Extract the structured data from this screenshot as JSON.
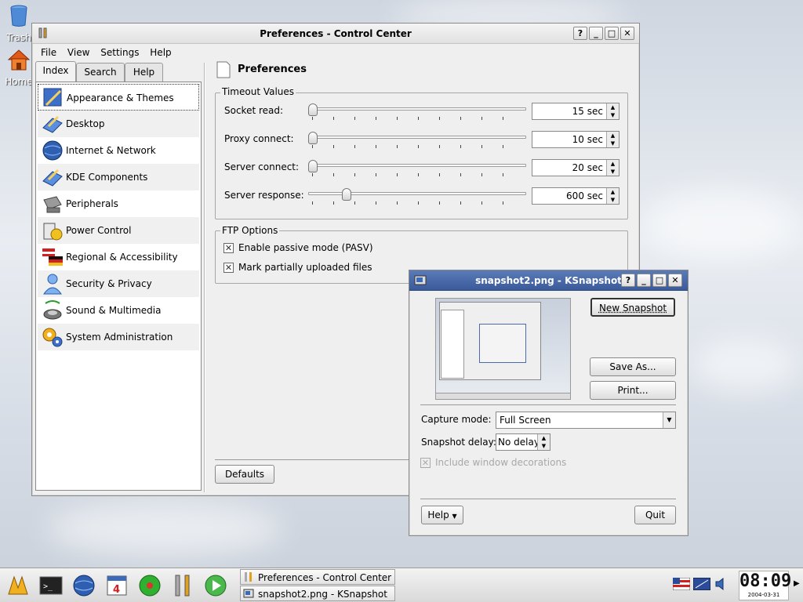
{
  "desktop": {
    "icons": [
      {
        "label": "Trash",
        "icon": "trash-icon"
      },
      {
        "label": "Home",
        "icon": "home-icon"
      }
    ]
  },
  "control_center": {
    "title": "Preferences - Control Center",
    "title_buttons": [
      "?",
      "_",
      "□",
      "✕"
    ],
    "menu": [
      "File",
      "View",
      "Settings",
      "Help"
    ],
    "tabs": [
      "Index",
      "Search",
      "Help"
    ],
    "categories": [
      {
        "label": "Appearance & Themes",
        "icon": "appearance-icon"
      },
      {
        "label": "Desktop",
        "icon": "desktop-icon"
      },
      {
        "label": "Internet & Network",
        "icon": "globe-icon"
      },
      {
        "label": "KDE Components",
        "icon": "kde-components-icon"
      },
      {
        "label": "Peripherals",
        "icon": "peripherals-icon"
      },
      {
        "label": "Power Control",
        "icon": "power-icon"
      },
      {
        "label": "Regional & Accessibility",
        "icon": "flags-icon"
      },
      {
        "label": "Security & Privacy",
        "icon": "user-icon"
      },
      {
        "label": "Sound & Multimedia",
        "icon": "speaker-icon"
      },
      {
        "label": "System Administration",
        "icon": "gears-icon"
      }
    ],
    "page_title": "Preferences",
    "timeout_group": {
      "title": "Timeout Values",
      "rows": [
        {
          "label": "Socket read:",
          "value": "15 sec",
          "slider_fraction": 0.0
        },
        {
          "label": "Proxy connect:",
          "value": "10 sec",
          "slider_fraction": 0.0
        },
        {
          "label": "Server connect:",
          "value": "20 sec",
          "slider_fraction": 0.0
        },
        {
          "label": "Server response:",
          "value": "600 sec",
          "slider_fraction": 0.18
        }
      ]
    },
    "ftp_group": {
      "title": "FTP Options",
      "options": [
        {
          "label": "Enable passive mode (PASV)",
          "checked": true
        },
        {
          "label": "Mark partially uploaded files",
          "checked": true
        }
      ]
    },
    "defaults_button": "Defaults"
  },
  "ksnapshot": {
    "title": "snapshot2.png - KSnapshot",
    "title_buttons": [
      "?",
      "_",
      "□",
      "✕"
    ],
    "new_snapshot": "New Snapshot",
    "save_as": "Save As...",
    "print": "Print...",
    "capture_mode_label": "Capture mode:",
    "capture_mode_value": "Full Screen",
    "snapshot_delay_label": "Snapshot delay:",
    "snapshot_delay_value": "No delay",
    "include_decorations": "Include window decorations",
    "help_button": "Help",
    "quit_button": "Quit"
  },
  "taskbar": {
    "tasks": [
      {
        "label": "Preferences - Control Center"
      },
      {
        "label": "snapshot2.png - KSnapshot"
      }
    ],
    "clock_time": "08:09",
    "clock_date": "2004-03-31",
    "tray_icons": [
      "flag-icon",
      "monitor-icon",
      "volume-icon"
    ]
  }
}
